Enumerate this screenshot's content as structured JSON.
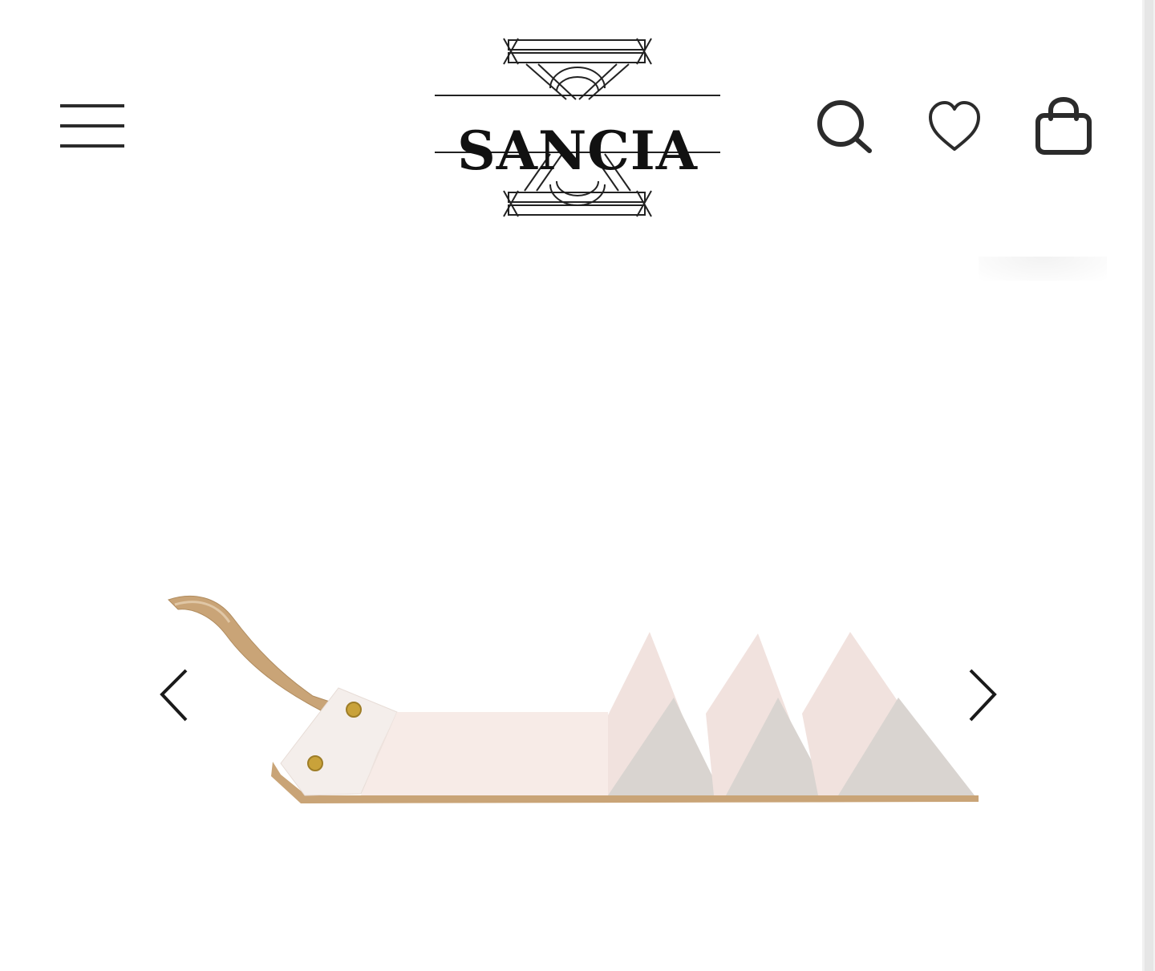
{
  "header": {
    "brand_name": "SANCIA",
    "menu_icon": "hamburger-menu-icon",
    "search_icon": "search-icon",
    "wishlist_icon": "heart-icon",
    "bag_icon": "shopping-bag-icon"
  },
  "gallery": {
    "prev_icon": "chevron-left-icon",
    "next_icon": "chevron-right-icon"
  },
  "colors": {
    "icon": "#2b2b2b",
    "leather_tan": "#c9a477",
    "interior_pink": "#f3e2dd",
    "triangle_gray": "#d9d4d0",
    "snap_gold": "#c9a23a"
  }
}
